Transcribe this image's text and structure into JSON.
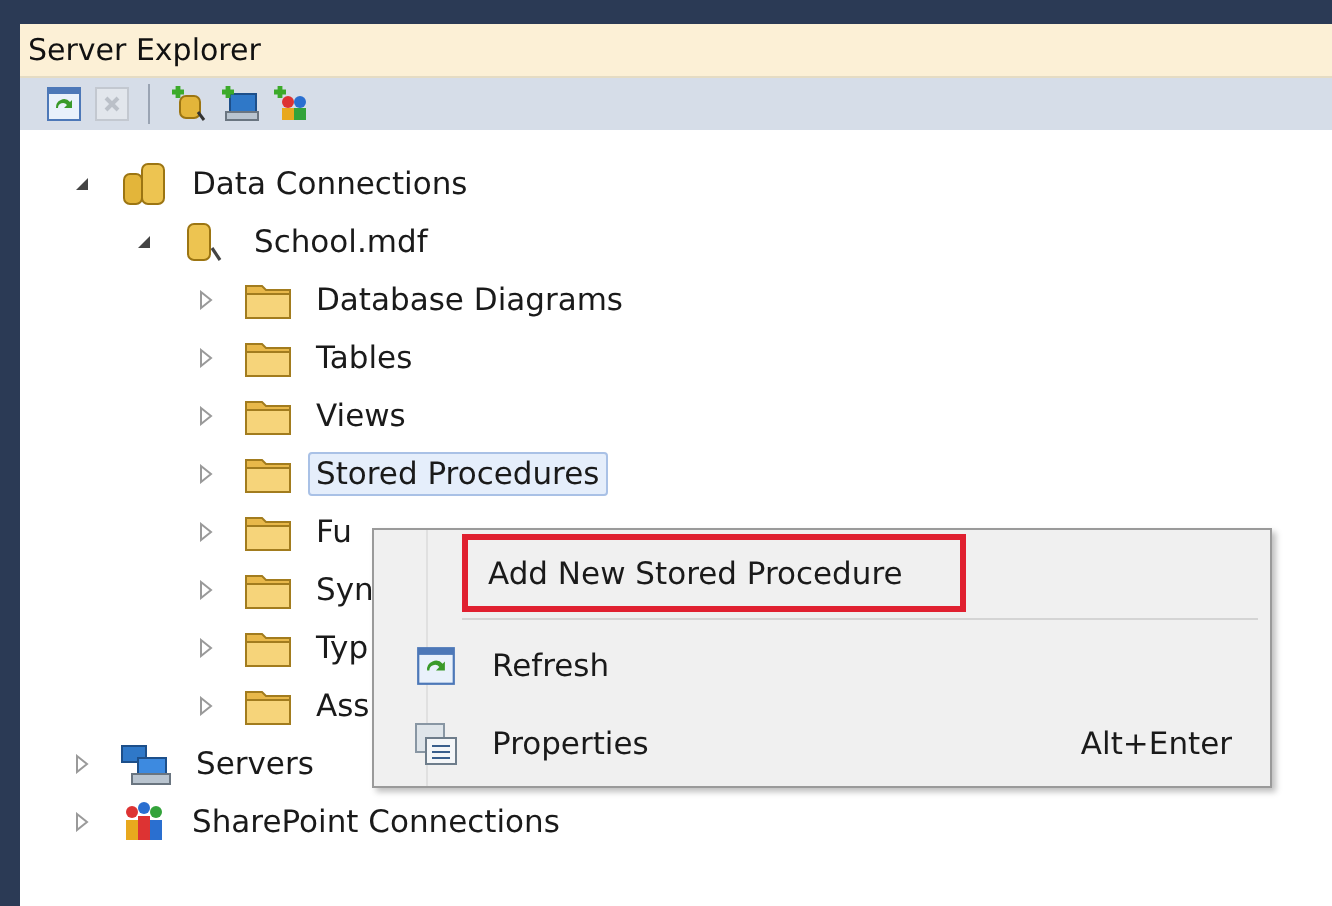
{
  "window": {
    "title": "Server Explorer"
  },
  "toolbar": [
    {
      "kind": "refresh",
      "disabled": false
    },
    {
      "kind": "delete",
      "disabled": true
    },
    {
      "kind": "connect-database",
      "disabled": false
    },
    {
      "kind": "connect-server",
      "disabled": false
    },
    {
      "kind": "connect-sharepoint",
      "disabled": false
    }
  ],
  "tree": [
    {
      "label": "Data Connections",
      "kind": "database",
      "expanded": true,
      "selected": false,
      "children": [
        {
          "label": "School.mdf",
          "kind": "db-file",
          "expanded": true,
          "selected": false,
          "children": [
            {
              "label": "Database Diagrams",
              "kind": "folder",
              "expanded": false,
              "selected": false
            },
            {
              "label": "Tables",
              "kind": "folder",
              "expanded": false,
              "selected": false
            },
            {
              "label": "Views",
              "kind": "folder",
              "expanded": false,
              "selected": false
            },
            {
              "label": "Stored Procedures",
              "kind": "folder",
              "expanded": false,
              "selected": true
            },
            {
              "label": "Fu",
              "kind": "folder",
              "expanded": false,
              "selected": false
            },
            {
              "label": "Syn",
              "kind": "folder",
              "expanded": false,
              "selected": false
            },
            {
              "label": "Typ",
              "kind": "folder",
              "expanded": false,
              "selected": false
            },
            {
              "label": "Ass",
              "kind": "folder",
              "expanded": false,
              "selected": false
            }
          ]
        }
      ]
    },
    {
      "label": "Servers",
      "kind": "servers",
      "expanded": false,
      "selected": false
    },
    {
      "label": "SharePoint Connections",
      "kind": "sharepoint",
      "expanded": false,
      "selected": false
    }
  ],
  "context_menu": {
    "items": [
      {
        "label": "Add New Stored Procedure",
        "kind": "plain",
        "highlighted": true
      },
      {
        "label": "Refresh",
        "kind": "refresh",
        "highlighted": false
      },
      {
        "label": "Properties",
        "kind": "properties",
        "shortcut": "Alt+Enter",
        "highlighted": false
      }
    ]
  }
}
